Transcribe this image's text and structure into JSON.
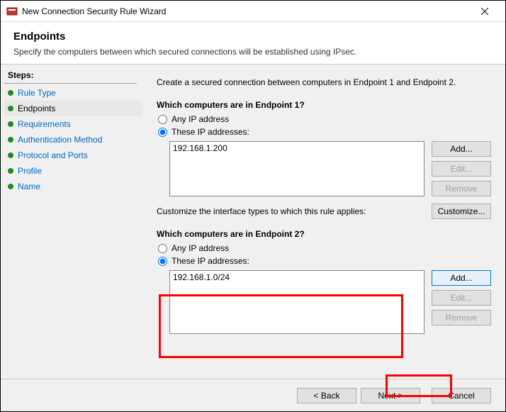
{
  "window": {
    "title": "New Connection Security Rule Wizard"
  },
  "header": {
    "title": "Endpoints",
    "subtitle": "Specify the computers between which secured connections will be established using IPsec."
  },
  "sidebar": {
    "heading": "Steps:",
    "items": [
      {
        "label": "Rule Type"
      },
      {
        "label": "Endpoints"
      },
      {
        "label": "Requirements"
      },
      {
        "label": "Authentication Method"
      },
      {
        "label": "Protocol and Ports"
      },
      {
        "label": "Profile"
      },
      {
        "label": "Name"
      }
    ]
  },
  "main": {
    "intro": "Create a secured connection between computers in Endpoint 1 and Endpoint 2.",
    "ep1": {
      "question": "Which computers are in Endpoint 1?",
      "any": "Any IP address",
      "these": "These IP addresses:",
      "list": [
        "192.168.1.200"
      ]
    },
    "ep2": {
      "question": "Which computers are in Endpoint 2?",
      "any": "Any IP address",
      "these": "These IP addresses:",
      "list": [
        "192.168.1.0/24"
      ]
    },
    "customize_text": "Customize the interface types to which this rule applies:",
    "buttons": {
      "add": "Add...",
      "edit": "Edit...",
      "remove": "Remove",
      "customize": "Customize..."
    }
  },
  "footer": {
    "back": "< Back",
    "next": "Next >",
    "cancel": "Cancel"
  }
}
